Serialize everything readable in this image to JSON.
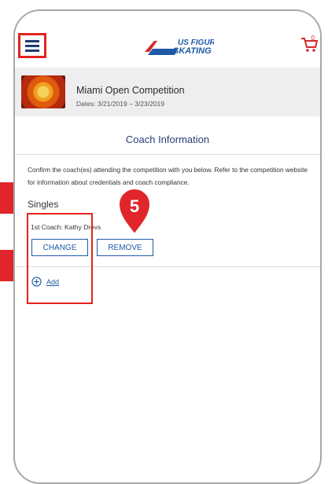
{
  "header": {
    "menu_icon": "hamburger-menu-icon",
    "logo_text_line1": "US FIGURE",
    "logo_text_line2": "SKATING",
    "cart_icon": "cart-icon",
    "cart_count": "0"
  },
  "event": {
    "title": "Miami Open Competition",
    "dates": "Dates: 3/21/2019 – 3/23/2019",
    "thumbnail_icon": "flower-thumbnail"
  },
  "page": {
    "title": "Coach Information",
    "instructions": "Confirm the coach(es) attending the competition with you below. Refer to the competition website for information about credentials and coach compliance."
  },
  "groups": [
    {
      "title": "Singles",
      "coach_line": "1st Coach: Kathy Drevs",
      "change_label": "CHANGE",
      "remove_label": "REMOVE",
      "add_label": "Add"
    }
  ],
  "annotation": {
    "step_number": "5",
    "accent": "#e0262a"
  },
  "colors": {
    "primary": "#1f5aa6",
    "heading": "#2a3d78",
    "event_bar_bg": "#eeeeee"
  }
}
